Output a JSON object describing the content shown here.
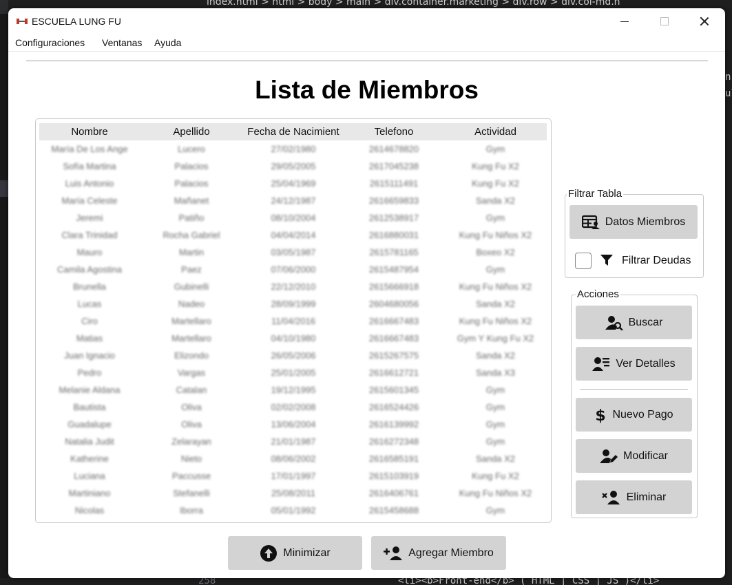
{
  "background_editor": {
    "breadcrumb": "index.html > html > body > main > div.container.marketing > div.row > div.col-md.n",
    "line_number": "258",
    "code_line": "<li><b>Front-end</b> ( HTML | CSS | JS )</li>",
    "right_glyphs": [
      "n",
      "ul"
    ]
  },
  "window": {
    "title": "ESCUELA LUNG FU"
  },
  "menu": [
    "Configuraciones",
    "Ventanas",
    "Ayuda"
  ],
  "page_title": "Lista de Miembros",
  "table": {
    "columns": [
      "Nombre",
      "Apellido",
      "Fecha de Nacimient",
      "Telefono",
      "Actividad"
    ],
    "rows": [
      [
        "María De Los Ange",
        "Lucero",
        "27/02/1980",
        "2614678820",
        "Gym"
      ],
      [
        "Sofía Martina",
        "Palacios",
        "29/05/2005",
        "2617045238",
        "Kung Fu X2"
      ],
      [
        "Luis Antonio",
        "Palacios",
        "25/04/1969",
        "2615111491",
        "Kung Fu X2"
      ],
      [
        "María Celeste",
        "Mañanet",
        "24/12/1987",
        "2616659833",
        "Sanda X2"
      ],
      [
        "Jeremi",
        "Patiño",
        "08/10/2004",
        "2612538917",
        "Gym"
      ],
      [
        "Clara Trinidad",
        "Rocha Gabriel",
        "04/04/2014",
        "2616880031",
        "Kung Fu Niños X2"
      ],
      [
        "Mauro",
        "Martin",
        "03/05/1987",
        "2615781165",
        "Boxeo X2"
      ],
      [
        "Camila Agostina",
        "Paez",
        "07/06/2000",
        "2615487954",
        "Gym"
      ],
      [
        "Brunella",
        "Gubinelli",
        "22/12/2010",
        "2615666918",
        "Kung Fu Niños X2"
      ],
      [
        "Lucas",
        "Nadeo",
        "28/09/1999",
        "2604680056",
        "Sanda X2"
      ],
      [
        "Ciro",
        "Martellaro",
        "11/04/2016",
        "2616667483",
        "Kung Fu Niños X2"
      ],
      [
        "Matias",
        "Martellaro",
        "04/10/1980",
        "2616667483",
        "Gym Y Kung Fu X2"
      ],
      [
        "Juan Ignacio",
        "Elizondo",
        "26/05/2006",
        "2615267575",
        "Sanda X2"
      ],
      [
        "Pedro",
        "Vargas",
        "25/01/2005",
        "2616612721",
        "Sanda X3"
      ],
      [
        "Melanie Aldana",
        "Catalan",
        "19/12/1995",
        "2615601345",
        "Gym"
      ],
      [
        "Bautista",
        "Oliva",
        "02/02/2008",
        "2616524426",
        "Gym"
      ],
      [
        "Guadalupe",
        "Oliva",
        "13/06/2004",
        "2616139992",
        "Gym"
      ],
      [
        "Natalia Judit",
        "Zelarayan",
        "21/01/1987",
        "2616272348",
        "Gym"
      ],
      [
        "Katherine",
        "Nieto",
        "08/06/2002",
        "2616585191",
        "Sanda X2"
      ],
      [
        "Luciana",
        "Paccusse",
        "17/01/1997",
        "2615103919",
        "Kung Fu X2"
      ],
      [
        "Martiniano",
        "Stefanelli",
        "25/08/2011",
        "2616406761",
        "Kung Fu Niños X2"
      ],
      [
        "Nicolas",
        "Iborra",
        "05/01/1992",
        "2615458688",
        "Gym"
      ]
    ]
  },
  "filter_group": {
    "title": "Filtrar Tabla",
    "datos_button": "Datos Miembros",
    "deudas_label": "Filtrar Deudas",
    "deudas_checked": false
  },
  "actions_group": {
    "title": "Acciones",
    "buscar": "Buscar",
    "ver_detalles": "Ver Detalles",
    "nuevo_pago": "Nuevo Pago",
    "modificar": "Modificar",
    "eliminar": "Eliminar"
  },
  "bottom_buttons": {
    "minimizar": "Minimizar",
    "agregar": "Agregar Miembro"
  },
  "colors": {
    "button_bg": "#d3d3d3",
    "header_bg": "#e8e8e8",
    "border": "#c8c8c8"
  }
}
